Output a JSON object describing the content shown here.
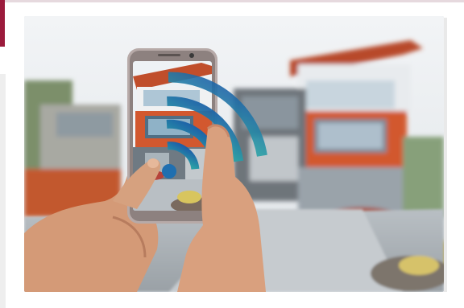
{
  "photo": {
    "subject": "hand-holding-smartphone-over-house",
    "icons": [
      "wifi-icon"
    ],
    "colors": {
      "accent": "#9b1b3c",
      "sky": "#eef1f4",
      "house_orange": "#d2582f",
      "house_gray": "#7c8a96",
      "wifi_blue": "#1f6fb0",
      "wifi_teal": "#2a9fa6",
      "skin": "#d9a07e",
      "phone_body": "#b7aaa8"
    }
  }
}
